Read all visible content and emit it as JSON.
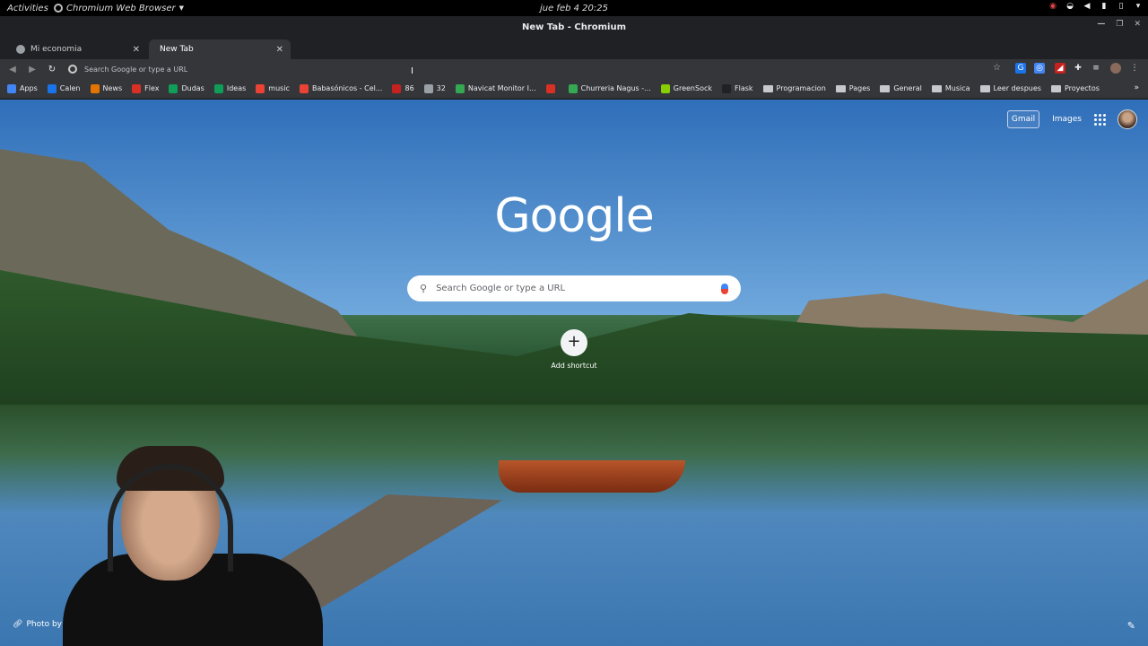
{
  "system_bar": {
    "activities": "Activities",
    "app_name": "Chromium Web Browser",
    "clock": "jue feb 4  20:25"
  },
  "window": {
    "title": "New Tab - Chromium"
  },
  "tabs": [
    {
      "label": "Mi economia",
      "active": false
    },
    {
      "label": "New Tab",
      "active": true
    }
  ],
  "toolbar": {
    "omnibox_placeholder": "Search Google or type a URL"
  },
  "bookmarks": [
    {
      "label": "Apps",
      "color": "#4285f4",
      "type": "apps"
    },
    {
      "label": "Calen",
      "color": "#1a73e8",
      "type": "link"
    },
    {
      "label": "News",
      "color": "#e37400",
      "type": "link"
    },
    {
      "label": "Flex",
      "color": "#d93025",
      "type": "link"
    },
    {
      "label": "Dudas",
      "color": "#0f9d58",
      "type": "link"
    },
    {
      "label": "Ideas",
      "color": "#0f9d58",
      "type": "link"
    },
    {
      "label": "music",
      "color": "#ea4335",
      "type": "link"
    },
    {
      "label": "Babasónicos - Cel...",
      "color": "#ea4335",
      "type": "link"
    },
    {
      "label": "86",
      "color": "#c5221f",
      "type": "link"
    },
    {
      "label": "32",
      "color": "#9aa0a6",
      "type": "link"
    },
    {
      "label": "Navicat Monitor I...",
      "color": "#34a853",
      "type": "link"
    },
    {
      "label": "",
      "color": "#d93025",
      "type": "link"
    },
    {
      "label": "Churreria Nagus -...",
      "color": "#34a853",
      "type": "link"
    },
    {
      "label": "GreenSock",
      "color": "#88ce02",
      "type": "link"
    },
    {
      "label": "Flask",
      "color": "#202124",
      "type": "link"
    },
    {
      "label": "Programacion",
      "type": "folder"
    },
    {
      "label": "Pages",
      "type": "folder"
    },
    {
      "label": "General",
      "type": "folder"
    },
    {
      "label": "Musica",
      "type": "folder"
    },
    {
      "label": "Leer despues",
      "type": "folder"
    },
    {
      "label": "Proyectos",
      "type": "folder"
    }
  ],
  "ntp": {
    "gmail": "Gmail",
    "images": "Images",
    "logo": "Google",
    "search_placeholder": "Search Google or type a URL",
    "add_shortcut": "Add shortcut",
    "photo_by": "Photo by "
  }
}
